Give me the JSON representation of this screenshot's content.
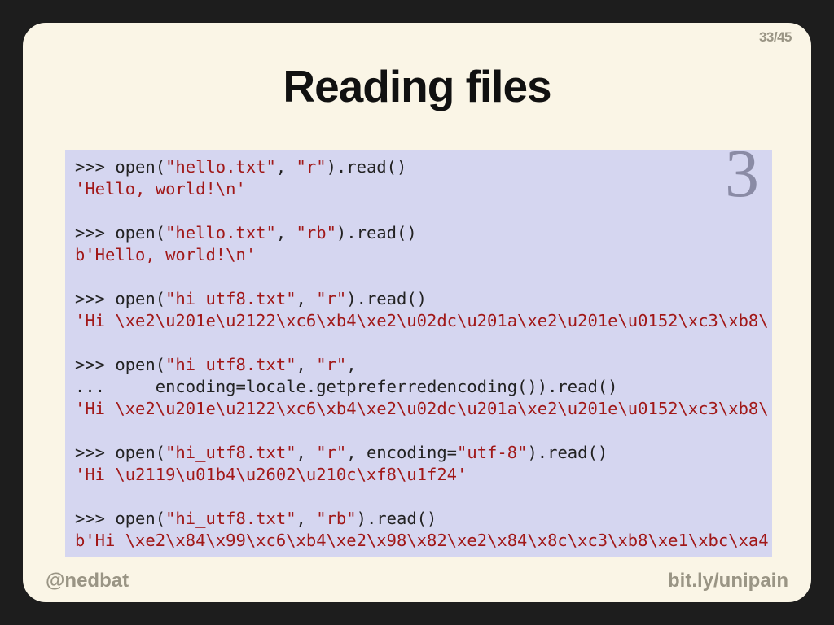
{
  "pager": {
    "current": 33,
    "total": 45,
    "display": "33/45"
  },
  "title": "Reading files",
  "pybadge": "3",
  "footer": {
    "left": "@nedbat",
    "right": "bit.ly/unipain"
  },
  "code": {
    "l01a": ">>> open(",
    "l01b": "\"hello.txt\"",
    "l01c": ", ",
    "l01d": "\"r\"",
    "l01e": ").read()",
    "l02": "'Hello, world!\\n'",
    "l03a": ">>> open(",
    "l03b": "\"hello.txt\"",
    "l03c": ", ",
    "l03d": "\"rb\"",
    "l03e": ").read()",
    "l04": "b'Hello, world!\\n'",
    "l05a": ">>> open(",
    "l05b": "\"hi_utf8.txt\"",
    "l05c": ", ",
    "l05d": "\"r\"",
    "l05e": ").read()",
    "l06": "'Hi \\xe2\\u201e\\u2122\\xc6\\xb4\\xe2\\u02dc\\u201a\\xe2\\u201e\\u0152\\xc3\\xb8\\",
    "l07a": ">>> open(",
    "l07b": "\"hi_utf8.txt\"",
    "l07c": ", ",
    "l07d": "\"r\"",
    "l07e": ",",
    "l08": "...     encoding=locale.getpreferredencoding()).read()",
    "l09": "'Hi \\xe2\\u201e\\u2122\\xc6\\xb4\\xe2\\u02dc\\u201a\\xe2\\u201e\\u0152\\xc3\\xb8\\",
    "l10a": ">>> open(",
    "l10b": "\"hi_utf8.txt\"",
    "l10c": ", ",
    "l10d": "\"r\"",
    "l10e": ", encoding=",
    "l10f": "\"utf-8\"",
    "l10g": ").read()",
    "l11": "'Hi \\u2119\\u01b4\\u2602\\u210c\\xf8\\u1f24'",
    "l12a": ">>> open(",
    "l12b": "\"hi_utf8.txt\"",
    "l12c": ", ",
    "l12d": "\"rb\"",
    "l12e": ").read()",
    "l13": "b'Hi \\xe2\\x84\\x99\\xc6\\xb4\\xe2\\x98\\x82\\xe2\\x84\\x8c\\xc3\\xb8\\xe1\\xbc\\xa4"
  }
}
